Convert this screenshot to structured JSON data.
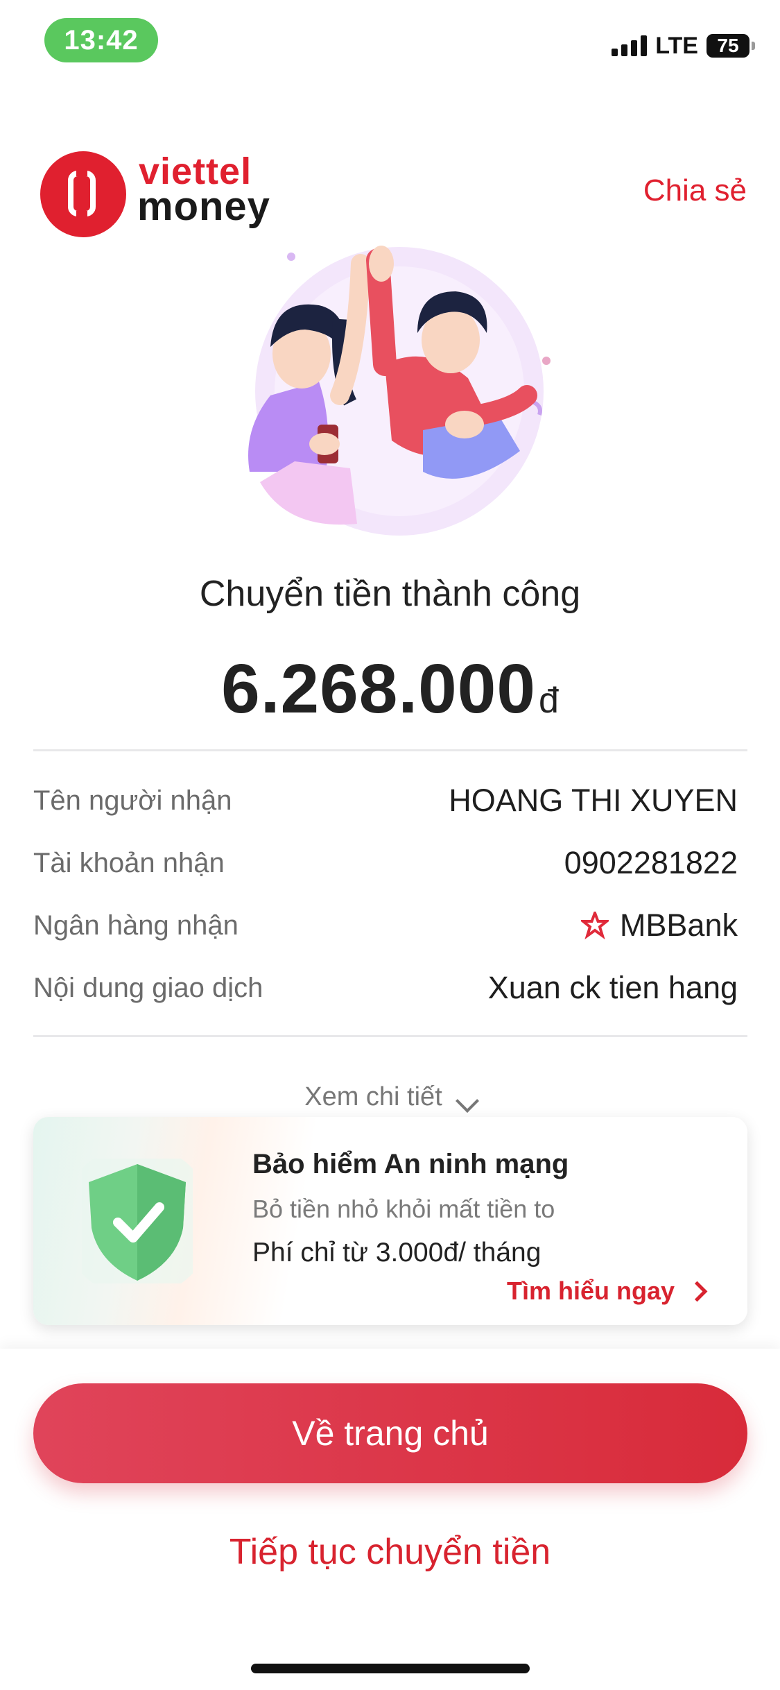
{
  "status_bar": {
    "time": "13:42",
    "network": "LTE",
    "battery": "75"
  },
  "header": {
    "logo_line1": "viettel",
    "logo_line2": "money",
    "share_label": "Chia sẻ"
  },
  "transaction": {
    "title": "Chuyển tiền thành công",
    "amount": "6.268.000",
    "currency": "đ",
    "details": [
      {
        "label": "Tên người nhận",
        "value": "HOANG THI XUYEN"
      },
      {
        "label": "Tài khoản nhận",
        "value": "0902281822"
      },
      {
        "label": "Ngân hàng nhận",
        "value": "MBBank",
        "icon": "mbbank-logo-icon"
      },
      {
        "label": "Nội dung giao dịch",
        "value": "Xuan ck tien hang"
      }
    ],
    "view_detail_label": "Xem chi tiết"
  },
  "promo": {
    "title": "Bảo hiểm An ninh mạng",
    "subtitle": "Bỏ tiền nhỏ khỏi mất tiền to",
    "fee": "Phí chỉ từ 3.000đ/ tháng",
    "link_label": "Tìm hiểu ngay"
  },
  "actions": {
    "home_label": "Về trang chủ",
    "continue_label": "Tiếp tục chuyển tiền"
  },
  "colors": {
    "brand_red": "#e0202f",
    "button_gradient": [
      "#e0445a",
      "#d82b3a"
    ],
    "status_green": "#5ac85e"
  }
}
